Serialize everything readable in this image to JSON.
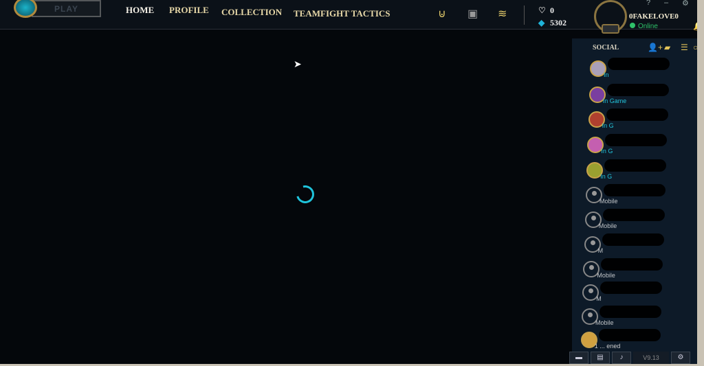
{
  "topbar": {
    "play": "PLAY",
    "nav": [
      "HOME",
      "PROFILE",
      "COLLECTION",
      "TEAMFIGHT TACTICS"
    ],
    "active": "HOME",
    "icons": [
      "missions-icon",
      "clash-icon",
      "store-icon"
    ],
    "rp_icon": "rp-icon",
    "rp": "0",
    "be_icon": "blue-essence-icon",
    "be": "5302",
    "username": "0FAKELOVE0",
    "status": "Online",
    "window": [
      "?",
      "–",
      "⚙",
      "✕"
    ]
  },
  "social": {
    "title": "SOCIAL",
    "icons": [
      "add-friend-icon",
      "add-folder-icon",
      "list-icon",
      "search-icon"
    ],
    "friends": [
      {
        "status": "In",
        "type": "game"
      },
      {
        "status": "In Game",
        "type": "game"
      },
      {
        "status": "In G",
        "type": "game"
      },
      {
        "status": "In G",
        "type": "game"
      },
      {
        "status": "In G",
        "type": "game"
      },
      {
        "status": "Mobile",
        "type": "mobile"
      },
      {
        "status": "Mobile",
        "type": "mobile"
      },
      {
        "status": "M",
        "type": "mobile"
      },
      {
        "status": "Mobile",
        "type": "mobile"
      },
      {
        "status": "M",
        "type": "mobile"
      },
      {
        "status": "Mobile",
        "type": "mobile"
      },
      {
        "status": "1 ... ened",
        "type": "other"
      }
    ]
  },
  "footer": {
    "version": "V9.13"
  },
  "colors": {
    "gold": "#e7d8a8",
    "accent": "#1fc3db",
    "online": "#2fc26a"
  }
}
